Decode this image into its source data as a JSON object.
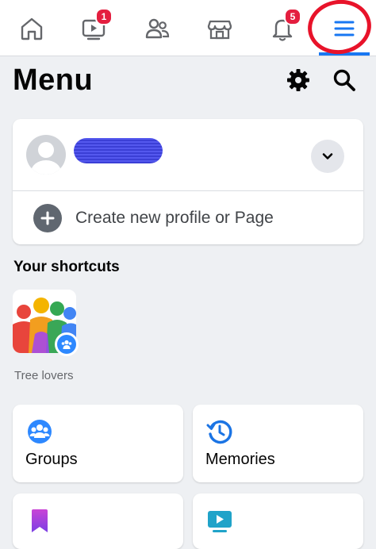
{
  "nav": {
    "items": [
      {
        "name": "home",
        "icon": "home-icon"
      },
      {
        "name": "watch",
        "icon": "video-icon",
        "badge": "1"
      },
      {
        "name": "friends",
        "icon": "friends-icon"
      },
      {
        "name": "marketplace",
        "icon": "store-icon"
      },
      {
        "name": "notifications",
        "icon": "bell-icon",
        "badge": "5"
      },
      {
        "name": "menu",
        "icon": "hamburger-icon",
        "active": true
      }
    ]
  },
  "header": {
    "title": "Menu",
    "icons": [
      "gear-icon",
      "search-icon"
    ]
  },
  "profile_card": {
    "create_label": "Create new profile or Page"
  },
  "shortcuts": {
    "title": "Your shortcuts",
    "items": [
      {
        "label": "Tree lovers",
        "badge_icon": "group-icon"
      }
    ]
  },
  "tiles": [
    {
      "label": "Groups",
      "icon": "groups-icon"
    },
    {
      "label": "Memories",
      "icon": "clock-icon"
    },
    {
      "label": "",
      "icon": "bookmark-icon"
    },
    {
      "label": "",
      "icon": "video-icon"
    }
  ],
  "colors": {
    "accent": "#1877f2",
    "badge": "#e41e3f",
    "annotation_circle": "#e8132a",
    "background": "#eef0f3"
  }
}
